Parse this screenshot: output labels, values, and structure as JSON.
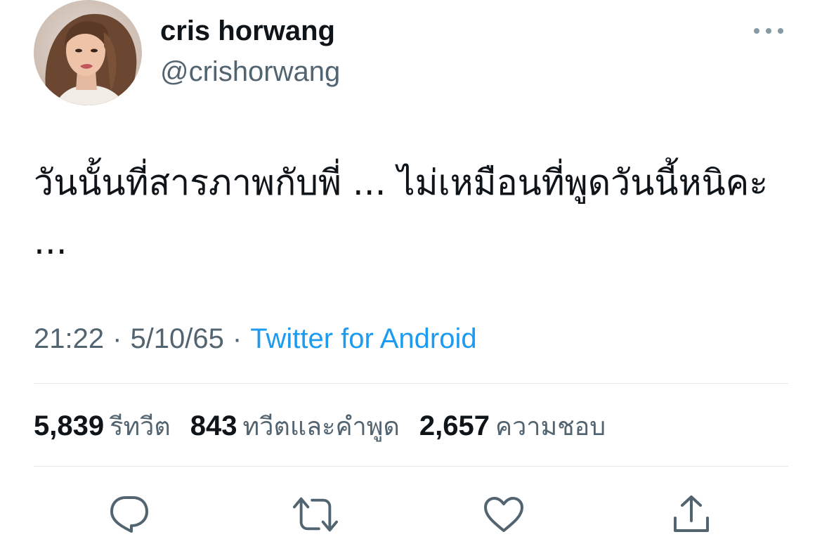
{
  "tweet": {
    "author": {
      "display_name": "cris horwang",
      "handle": "@crishorwang"
    },
    "text": "วันนั้นที่สารภาพกับพี่ ... ไม่เหมือนที่พูดวันนี้หนิคะ ...",
    "time": "21:22",
    "date": "5/10/65",
    "separator": "·",
    "source": "Twitter for Android"
  },
  "stats": [
    {
      "value": "5,839",
      "label": "รีทวีต"
    },
    {
      "value": "843",
      "label": "ทวีตและคำพูด"
    },
    {
      "value": "2,657",
      "label": "ความชอบ"
    }
  ],
  "icons": {
    "more": "more-horizontal-icon",
    "reply": "comment-bubble-icon",
    "retweet": "retweet-icon",
    "like": "heart-icon",
    "share": "share-upload-icon"
  },
  "colors": {
    "text": "#0f1419",
    "secondary": "#536471",
    "link": "#1d9bf0",
    "divider": "#e4e7ea"
  }
}
